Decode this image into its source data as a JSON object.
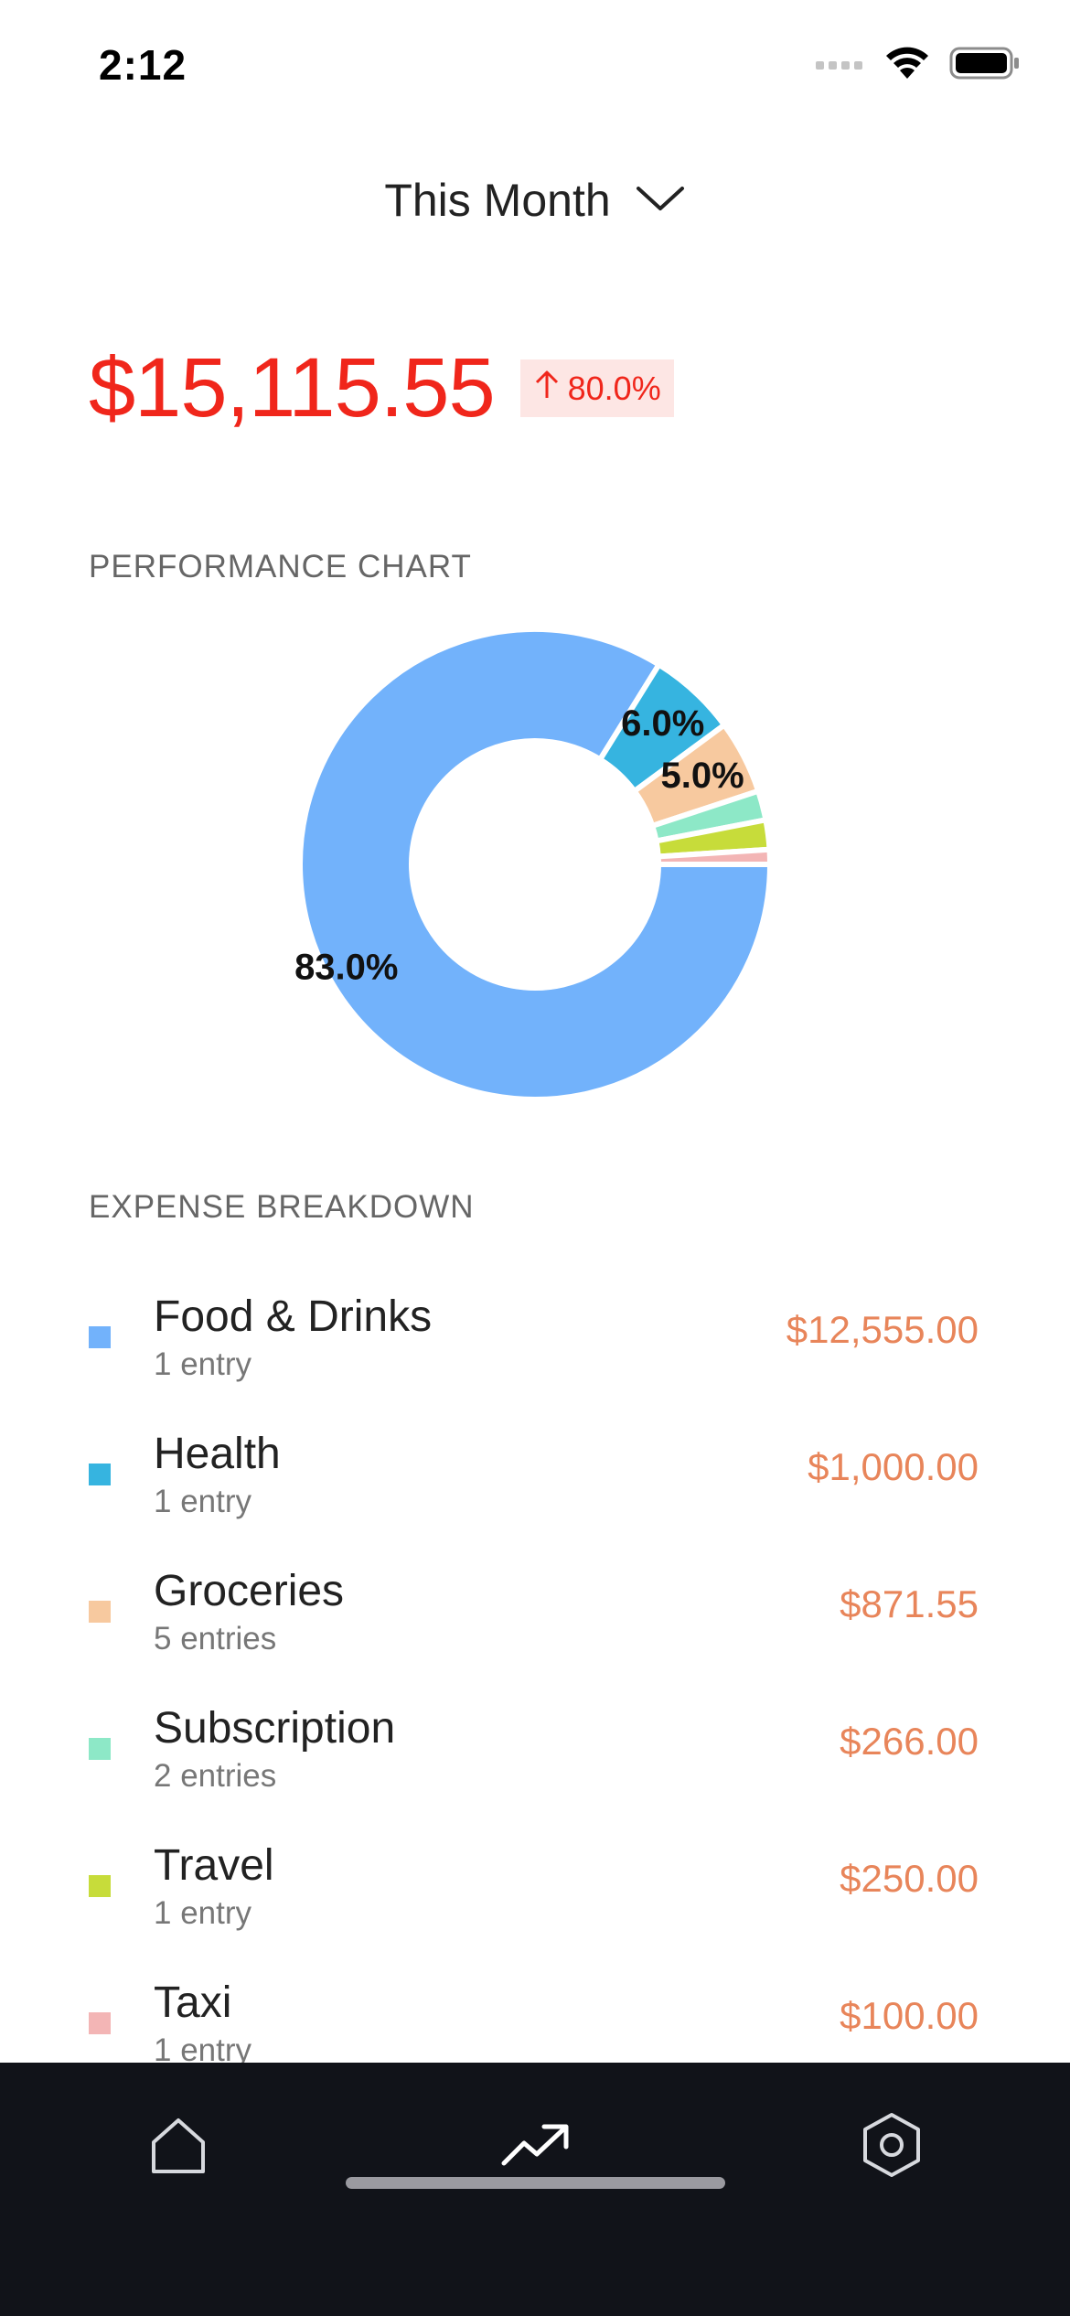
{
  "status_bar": {
    "time": "2:12",
    "icons": [
      "signal-icon",
      "wifi-icon",
      "battery-icon"
    ]
  },
  "period": {
    "label": "This Month",
    "icon": "chevron-down-icon"
  },
  "summary": {
    "total": "$15,115.55",
    "change": "80.0%",
    "change_icon": "arrow-up-icon",
    "total_color": "#f0261b"
  },
  "performance": {
    "title": "PERFORMANCE CHART"
  },
  "chart_data": {
    "type": "pie",
    "style": "donut",
    "slices": [
      {
        "label": "Food & Drinks",
        "value": 83.0,
        "color": "#72b2fb",
        "display": "83.0%"
      },
      {
        "label": "Health",
        "value": 6.0,
        "color": "#36b4e0",
        "display": "6.0%"
      },
      {
        "label": "Groceries",
        "value": 5.0,
        "color": "#f7c99f",
        "display": "5.0%"
      },
      {
        "label": "Subscription",
        "value": 2.0,
        "color": "#8de8c7",
        "display": ""
      },
      {
        "label": "Travel",
        "value": 2.0,
        "color": "#c7dc3a",
        "display": ""
      },
      {
        "label": "Taxi",
        "value": 1.0,
        "color": "#f3b5b5",
        "display": ""
      }
    ]
  },
  "breakdown": {
    "title": "EXPENSE BREAKDOWN",
    "items": [
      {
        "name": "Food & Drinks",
        "entries": "1 entry",
        "amount": "$12,555.00",
        "color": "#72b2fb"
      },
      {
        "name": "Health",
        "entries": "1 entry",
        "amount": "$1,000.00",
        "color": "#36b4e0"
      },
      {
        "name": "Groceries",
        "entries": "5 entries",
        "amount": "$871.55",
        "color": "#f7c99f"
      },
      {
        "name": "Subscription",
        "entries": "2 entries",
        "amount": "$266.00",
        "color": "#8de8c7"
      },
      {
        "name": "Travel",
        "entries": "1 entry",
        "amount": "$250.00",
        "color": "#c7dc3a"
      },
      {
        "name": "Taxi",
        "entries": "1 entry",
        "amount": "$100.00",
        "color": "#f3b5b5"
      }
    ]
  },
  "tab_bar": {
    "tabs": [
      {
        "name": "home",
        "icon": "home-icon"
      },
      {
        "name": "trends",
        "icon": "trending-up-icon",
        "active": true
      },
      {
        "name": "settings",
        "icon": "settings-icon"
      }
    ]
  }
}
